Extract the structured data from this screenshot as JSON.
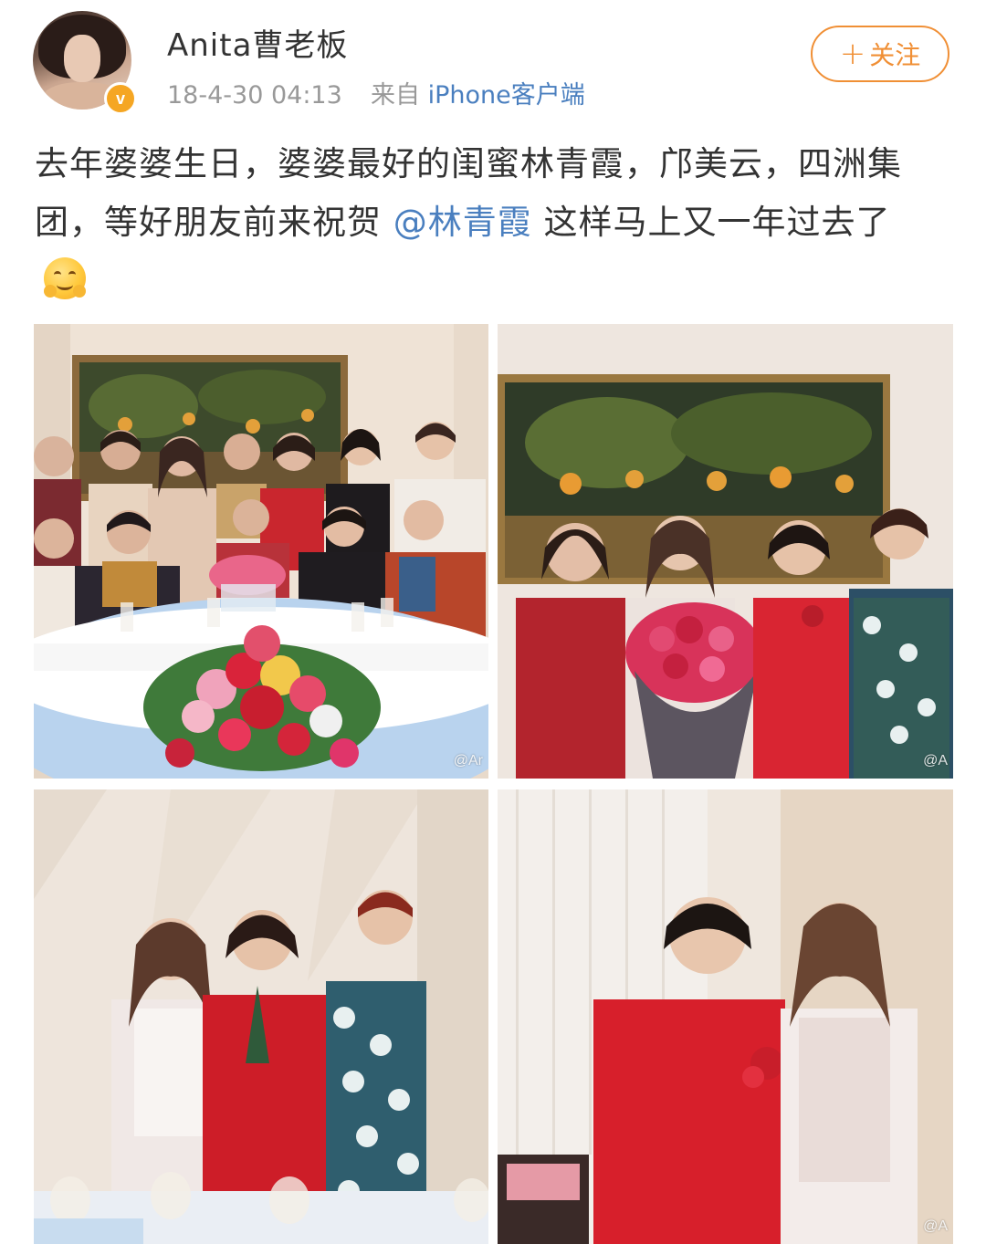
{
  "post": {
    "username": "Anita曹老板",
    "timestamp": "18-4-30 04:13",
    "source_prefix": "来自",
    "source": "iPhone客户端",
    "verified_badge": "v",
    "follow_label": "关注",
    "follow_plus": "+",
    "text_part1": "去年婆婆生日，婆婆最好的闺蜜林青霞，邝美云，四洲集团，等好朋友前来祝贺",
    "mention": "@林青霞",
    "text_part2": "这样马上又一年过去了",
    "emoji": "hugging-face-emoji"
  },
  "photos": {
    "watermark": "@Ar",
    "watermark2": "@A",
    "items": [
      {
        "name": "group-photo-dinner-table"
      },
      {
        "name": "group-photo-bouquet"
      },
      {
        "name": "three-women-photo"
      },
      {
        "name": "two-women-photo"
      }
    ]
  },
  "colors": {
    "accent_orange": "#f08f35",
    "link_blue": "#4a7fbf",
    "badge_yellow": "#f5a623",
    "meta_gray": "#999999"
  }
}
